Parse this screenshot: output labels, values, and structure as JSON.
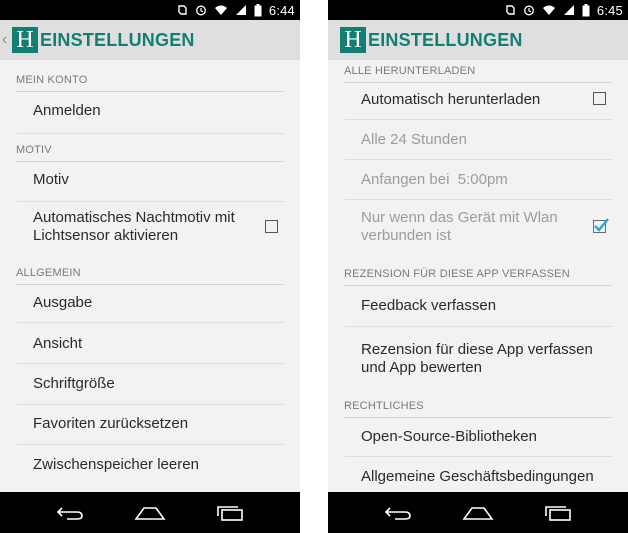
{
  "left": {
    "status": {
      "time": "6:44"
    },
    "title": "EINSTELLUNGEN",
    "logo": "H",
    "sections": [
      {
        "header": "MEIN KONTO",
        "items": [
          {
            "label": "Anmelden"
          }
        ]
      },
      {
        "header": "MOTIV",
        "items": [
          {
            "label": "Motiv"
          },
          {
            "label": "Automatisches Nachtmotiv mit Lichtsensor aktivieren",
            "checked": false
          }
        ]
      },
      {
        "header": "ALLGEMEIN",
        "items": [
          {
            "label": "Ausgabe"
          },
          {
            "label": "Ansicht"
          },
          {
            "label": "Schriftgröße"
          },
          {
            "label": "Favoriten zurücksetzen"
          },
          {
            "label": "Zwischenspeicher leeren"
          }
        ]
      }
    ]
  },
  "right": {
    "status": {
      "time": "6:45"
    },
    "title": "EINSTELLUNGEN",
    "logo": "H",
    "sections": [
      {
        "header": "ALLE HERUNTERLADEN",
        "items": [
          {
            "label": "Automatisch herunterladen",
            "checked": false
          },
          {
            "label": "Alle 24 Stunden",
            "disabled": true
          },
          {
            "label": "Anfangen bei  5:00pm",
            "disabled": true
          },
          {
            "label": "Nur wenn das Gerät mit Wlan verbunden ist",
            "disabled": true,
            "checked": true
          }
        ]
      },
      {
        "header": "REZENSION FÜR DIESE APP VERFASSEN",
        "items": [
          {
            "label": "Feedback verfassen"
          },
          {
            "label": "Rezension für diese App verfassen und App bewerten"
          }
        ]
      },
      {
        "header": "RECHTLICHES",
        "items": [
          {
            "label": "Open-Source-Bibliotheken"
          },
          {
            "label": "Allgemeine Geschäftsbedingungen"
          }
        ]
      }
    ]
  },
  "colors": {
    "accent": "#127f73",
    "actionbar": "#dfdfdf",
    "background": "#f2f2f2",
    "check": "#2aa6d8"
  },
  "icons": {
    "navbar": [
      "back-icon",
      "home-icon",
      "recents-icon"
    ]
  }
}
